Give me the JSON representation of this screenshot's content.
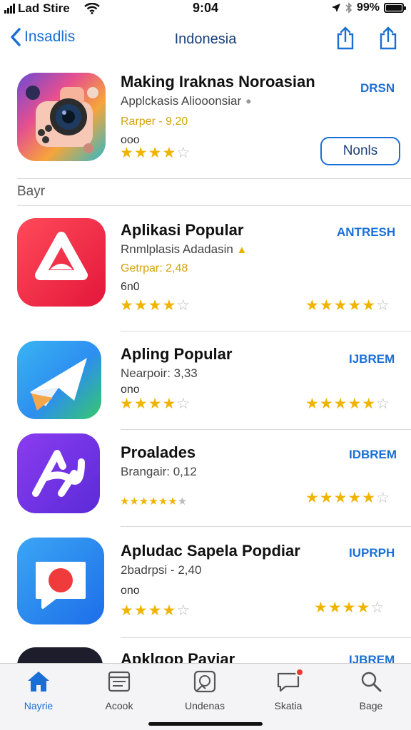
{
  "status_bar": {
    "carrier": "Lad Stire",
    "time": "9:04",
    "battery": "99%",
    "battery_level": 0.99
  },
  "nav": {
    "back_label": "Insadlis",
    "title": "Indonesia"
  },
  "featured": {
    "title": "Making Iraknas Noroasian",
    "subtitle": "Applckasis Aliooonsiar",
    "price": "Rarper - 9,20",
    "meta": "ooo",
    "rating": 4,
    "top_action": "DRSN",
    "button_label": "Nonls"
  },
  "section_label": "Bayr",
  "apps": [
    {
      "title": "Aplikasi Popular",
      "subtitle": "Rnmlplasis Adadasin",
      "price": "Getrpar: 2,48",
      "meta": "6n0",
      "rating": 4,
      "right_rating": 4.5,
      "action": "ANTRESH"
    },
    {
      "title": "Apling Popular",
      "subtitle": "Nearpoir: 3,33",
      "meta": "ono",
      "rating": 4,
      "right_rating": 4.5,
      "action": "IJBREM"
    },
    {
      "title": "Proalades",
      "subtitle": "Brangair: 0,12",
      "rating": 4,
      "right_rating": 4.5,
      "action": "IDBREM"
    },
    {
      "title": "Apludac Sapela Popdiar",
      "subtitle": "2badrpsi - 2,40",
      "meta": "ono",
      "rating": 4,
      "right_rating": 4,
      "action": "IUPRPH"
    },
    {
      "title": "Apklgop Payiar",
      "action": "IJBREM"
    }
  ],
  "tabs": [
    {
      "label": "Nayrie",
      "icon": "house-icon",
      "active": true
    },
    {
      "label": "Acook",
      "icon": "list-icon",
      "active": false
    },
    {
      "label": "Undenas",
      "icon": "photo-icon",
      "active": false
    },
    {
      "label": "Skatia",
      "icon": "chat-icon",
      "active": false
    },
    {
      "label": "Bage",
      "icon": "search-icon",
      "active": false
    }
  ],
  "colors": {
    "accent": "#1a6fd6",
    "star": "#f0b400",
    "price_gold": "#d4a30c"
  }
}
